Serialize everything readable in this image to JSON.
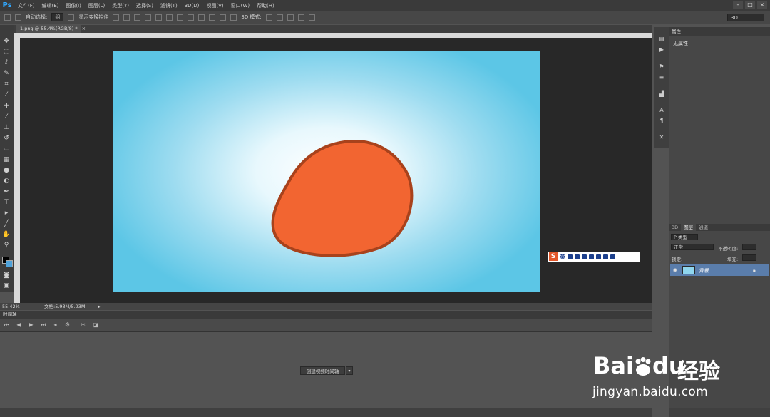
{
  "app": {
    "logo": "Ps"
  },
  "menu": [
    "文件(F)",
    "编辑(E)",
    "图像(I)",
    "图层(L)",
    "类型(Y)",
    "选择(S)",
    "滤镜(T)",
    "3D(D)",
    "视图(V)",
    "窗口(W)",
    "帮助(H)"
  ],
  "window_controls": [
    "-",
    "□",
    "×"
  ],
  "options": {
    "auto_select_label": "自动选择:",
    "auto_select_value": "组",
    "show_transform_label": "显示变换控件",
    "mode_3d_label": "3D 模式:",
    "workspace": "3D"
  },
  "document": {
    "tab_label": "1.png @ 55.4%(RGB/8) *",
    "close": "×"
  },
  "status": {
    "zoom": "55.42%",
    "doc_size": "文档:5.93M/5.93M"
  },
  "timeline": {
    "title": "时间轴",
    "create_button": "创建视频时间轴",
    "dropdown": "▾"
  },
  "properties": {
    "title": "属性",
    "content": "无属性"
  },
  "layers": {
    "tabs": [
      "3D",
      "图层",
      "通道"
    ],
    "active_tab": 1,
    "filter_label": "P 类型",
    "blend_mode": "正常",
    "opacity_label": "不透明度:",
    "lock_label": "锁定:",
    "fill_label": "填充:",
    "layer_name": "背景"
  },
  "ime": {
    "logo": "S",
    "label": "英"
  },
  "watermark": {
    "brand": "Bai",
    "brand2": "du",
    "jingyan": "经验",
    "url": "jingyan.baidu.com"
  },
  "colors": {
    "canvas_blob_fill": "#f26531",
    "canvas_blob_stroke": "#a8421c",
    "sky": "#5cc6e6",
    "layer_selected": "#5a7dab"
  },
  "icons": [
    "move-icon",
    "marquee-icon",
    "lasso-icon",
    "quick-select-icon",
    "crop-icon",
    "eyedropper-icon",
    "healing-icon",
    "brush-icon",
    "stamp-icon",
    "history-brush-icon",
    "eraser-icon",
    "gradient-icon",
    "blur-icon",
    "dodge-icon",
    "pen-icon",
    "type-icon",
    "path-select-icon",
    "line-icon",
    "hand-icon",
    "zoom-icon"
  ]
}
